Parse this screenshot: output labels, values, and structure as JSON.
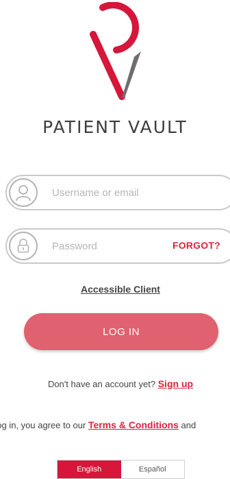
{
  "brand": {
    "name": "PATIENT VAULT",
    "colors": {
      "primary": "#d6163a",
      "secondary": "#6d6e71",
      "button": "#e0616f"
    }
  },
  "form": {
    "username_placeholder": "Username or email",
    "username_value": "",
    "username_icon": "user-icon",
    "password_placeholder": "Password",
    "password_value": "",
    "password_icon": "lock-icon",
    "forgot_label": "FORGOT?",
    "accessible_client_label": "Accessible Client",
    "login_label": "LOG IN"
  },
  "signup": {
    "prompt": "Don't have an account yet?",
    "link_label": "Sign up"
  },
  "terms": {
    "prefix": "Log in, you agree to our",
    "link_label": "Terms & Conditions",
    "suffix": "and"
  },
  "language": {
    "options": [
      "English",
      "Español"
    ],
    "selected": "English"
  }
}
